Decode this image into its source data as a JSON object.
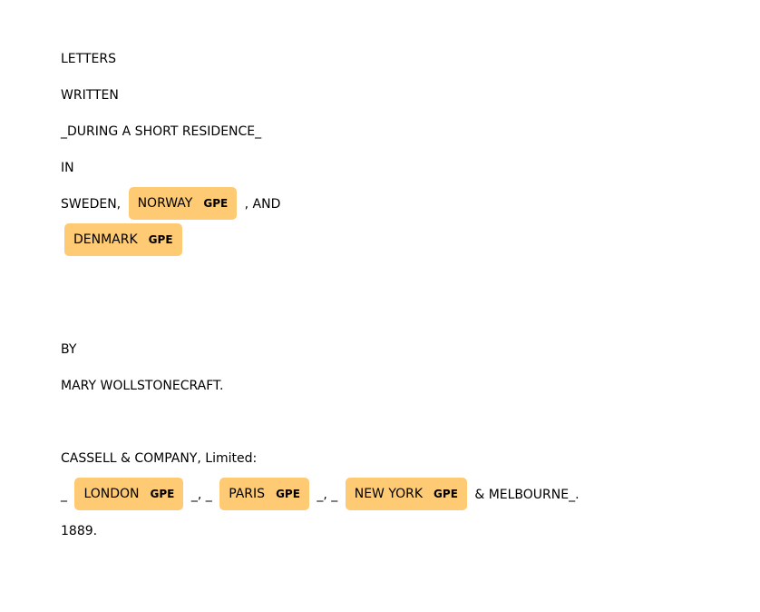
{
  "entity_color": "#feca74",
  "lines": {
    "l1": "LETTERS",
    "l2": "WRITTEN",
    "l3": "_DURING A SHORT RESIDENCE_",
    "l4": "IN",
    "l5_pre": "SWEDEN, ",
    "norway": {
      "text": "NORWAY",
      "label": "GPE"
    },
    "l5_post": " , AND",
    "denmark": {
      "text": "DENMARK",
      "label": "GPE"
    },
    "l7": "BY",
    "l8": "MARY WOLLSTONECRAFT.",
    "l9": "CASSELL & COMPANY, Limited:",
    "l10_pre": "_ ",
    "london": {
      "text": "LONDON",
      "label": "GPE"
    },
    "l10_mid1": " _, _ ",
    "paris": {
      "text": "PARIS",
      "label": "GPE"
    },
    "l10_mid2": " _, _ ",
    "newyork": {
      "text": "NEW YORK",
      "label": "GPE"
    },
    "l10_post": " & MELBOURNE_.",
    "l11": "1889."
  }
}
